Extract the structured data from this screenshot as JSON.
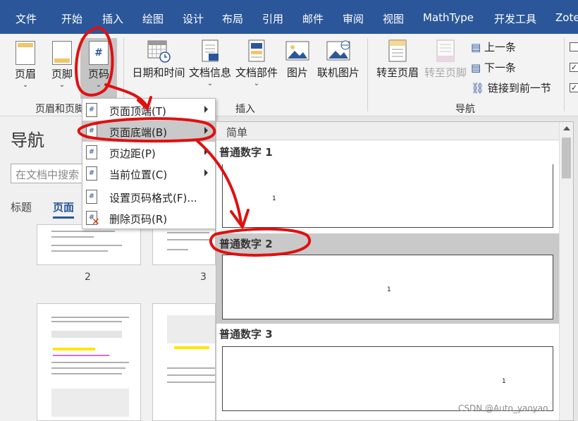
{
  "menubar": {
    "tabs": [
      "文件",
      "开始",
      "插入",
      "绘图",
      "设计",
      "布局",
      "引用",
      "邮件",
      "审阅",
      "视图",
      "MathType",
      "开发工具",
      "Zote"
    ]
  },
  "ribbon": {
    "header_footer_group": {
      "buttons": [
        "页眉",
        "页脚",
        "页码"
      ],
      "label": "页眉和页脚"
    },
    "insert_group": {
      "buttons": [
        "日期和时间",
        "文档信息",
        "文档部件",
        "图片",
        "联机图片"
      ],
      "label": "插入"
    },
    "navigation_group": {
      "goto_header": "转至页眉",
      "goto_footer": "转至页脚",
      "previous": "上一条",
      "next": "下一条",
      "link_previous": "链接到前一节",
      "label": "导航"
    }
  },
  "nav_pane": {
    "title": "导航",
    "search_placeholder": "在文档中搜索",
    "tabs": [
      "标题",
      "页面"
    ],
    "thumbnails": [
      "2",
      "3"
    ]
  },
  "context_menu": {
    "items": [
      {
        "icon": "page-number-icon",
        "label": "页面顶端(T)"
      },
      {
        "icon": "page-number-icon",
        "label": "页面底端(B)"
      },
      {
        "icon": "page-number-icon",
        "label": "页边距(P)"
      },
      {
        "icon": "page-number-icon",
        "label": "当前位置(C)"
      },
      {
        "icon": "page-number-icon",
        "label": "设置页码格式(F)..."
      },
      {
        "icon": "delete-page-number-icon",
        "label": "删除页码(R)"
      }
    ]
  },
  "gallery": {
    "header": "简单",
    "items": [
      {
        "label": "普通数字 1",
        "number": "1"
      },
      {
        "label": "普通数字 2",
        "number": "1"
      },
      {
        "label": "普通数字 3",
        "number": "1"
      }
    ]
  },
  "watermark": "CSDN @Auto_yaoyao",
  "colors": {
    "menubar": "#2b579a",
    "annotation": "#e01010",
    "highlight": "#c9c9c9"
  }
}
